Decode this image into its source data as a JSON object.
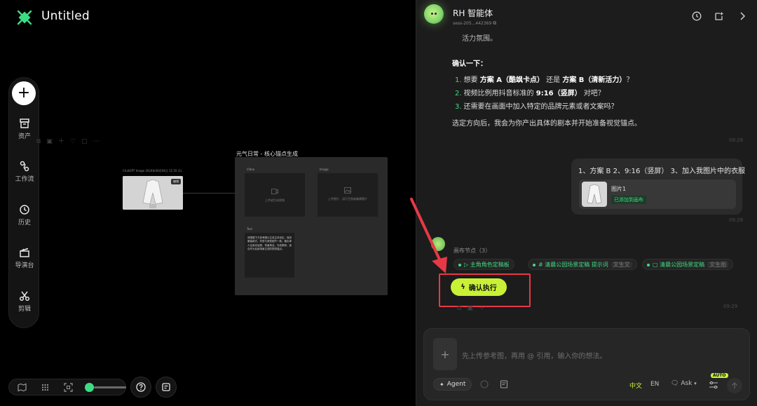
{
  "app": {
    "title": "Untitled"
  },
  "toolbar": {
    "add_symbol": "+",
    "items": [
      {
        "label": "资产"
      },
      {
        "label": "工作流"
      },
      {
        "label": "历史"
      },
      {
        "label": "导演台"
      },
      {
        "label": "剪辑"
      }
    ]
  },
  "canvas": {
    "photo_node_title": "ChatGPT Image 2024年06月04日 11:55 (1).png",
    "photo_node_tag": "编辑",
    "group_title": "元气日常 - 核心锚点生成",
    "cards": [
      {
        "header": "Video",
        "body": "上传或生成视频"
      },
      {
        "header": "Image",
        "body": "上传图片、运行生图或编辑图片"
      },
      {
        "header": "Text",
        "body": "请根据下方参考图片生成主体设定，保持服装款式、材质与造型细节一致，输出单人全身定妆照，背景简洁，光线柔和，适合作为后续场景生成的视觉锚点。"
      }
    ]
  },
  "panel": {
    "agent_name": "RH 智能体",
    "session_id": "sess-205...442369",
    "partial_text": "活力氛围。",
    "confirm_heading": "确认一下：",
    "list": [
      {
        "num": "1.",
        "pre": "想要 ",
        "b1": "方案 A（酷飒卡点）",
        "mid": " 还是 ",
        "b2": "方案 B（清新活力）",
        "post": "？"
      },
      {
        "num": "2.",
        "pre": "视频比例用抖音标准的 ",
        "b1": "9:16（竖屏）",
        "post": " 对吧？"
      },
      {
        "num": "3.",
        "pre": "还需要在画面中加入特定的品牌元素或者文案吗？"
      }
    ],
    "closing": "选定方向后，我会为你产出具体的剧本并开始准备视觉锚点。",
    "time_1": "09:28",
    "user_message": "1、方案 B 2、9:16（竖屏） 3、加入我图片中的衣服",
    "attachment_name": "图片1",
    "attachment_badge": "已添加到画布",
    "time_2": "09:28",
    "nodes_label": "画布节点（3）",
    "chips": [
      {
        "text": "▷ 主角角色定稿板",
        "tag": ""
      },
      {
        "text": "# 清晨公园场景定稿 提示词",
        "tag": "文生文"
      },
      {
        "text": "▢ 清晨公园场景定稿",
        "tag": "文生图"
      }
    ],
    "confirm_button": "确认执行",
    "time_3": "09:29",
    "composer": {
      "add_symbol": "+",
      "placeholder": "先上传参考图，再用 @ 引用，输入你的想法。",
      "agent_label": "Agent",
      "lang_zh": "中文",
      "lang_en": "EN",
      "ask_label": "Ask",
      "auto_badge": "AUTO"
    }
  },
  "colors": {
    "accent_green": "#3ddc84",
    "lime": "#c8f135",
    "highlight_red": "#e63946"
  }
}
